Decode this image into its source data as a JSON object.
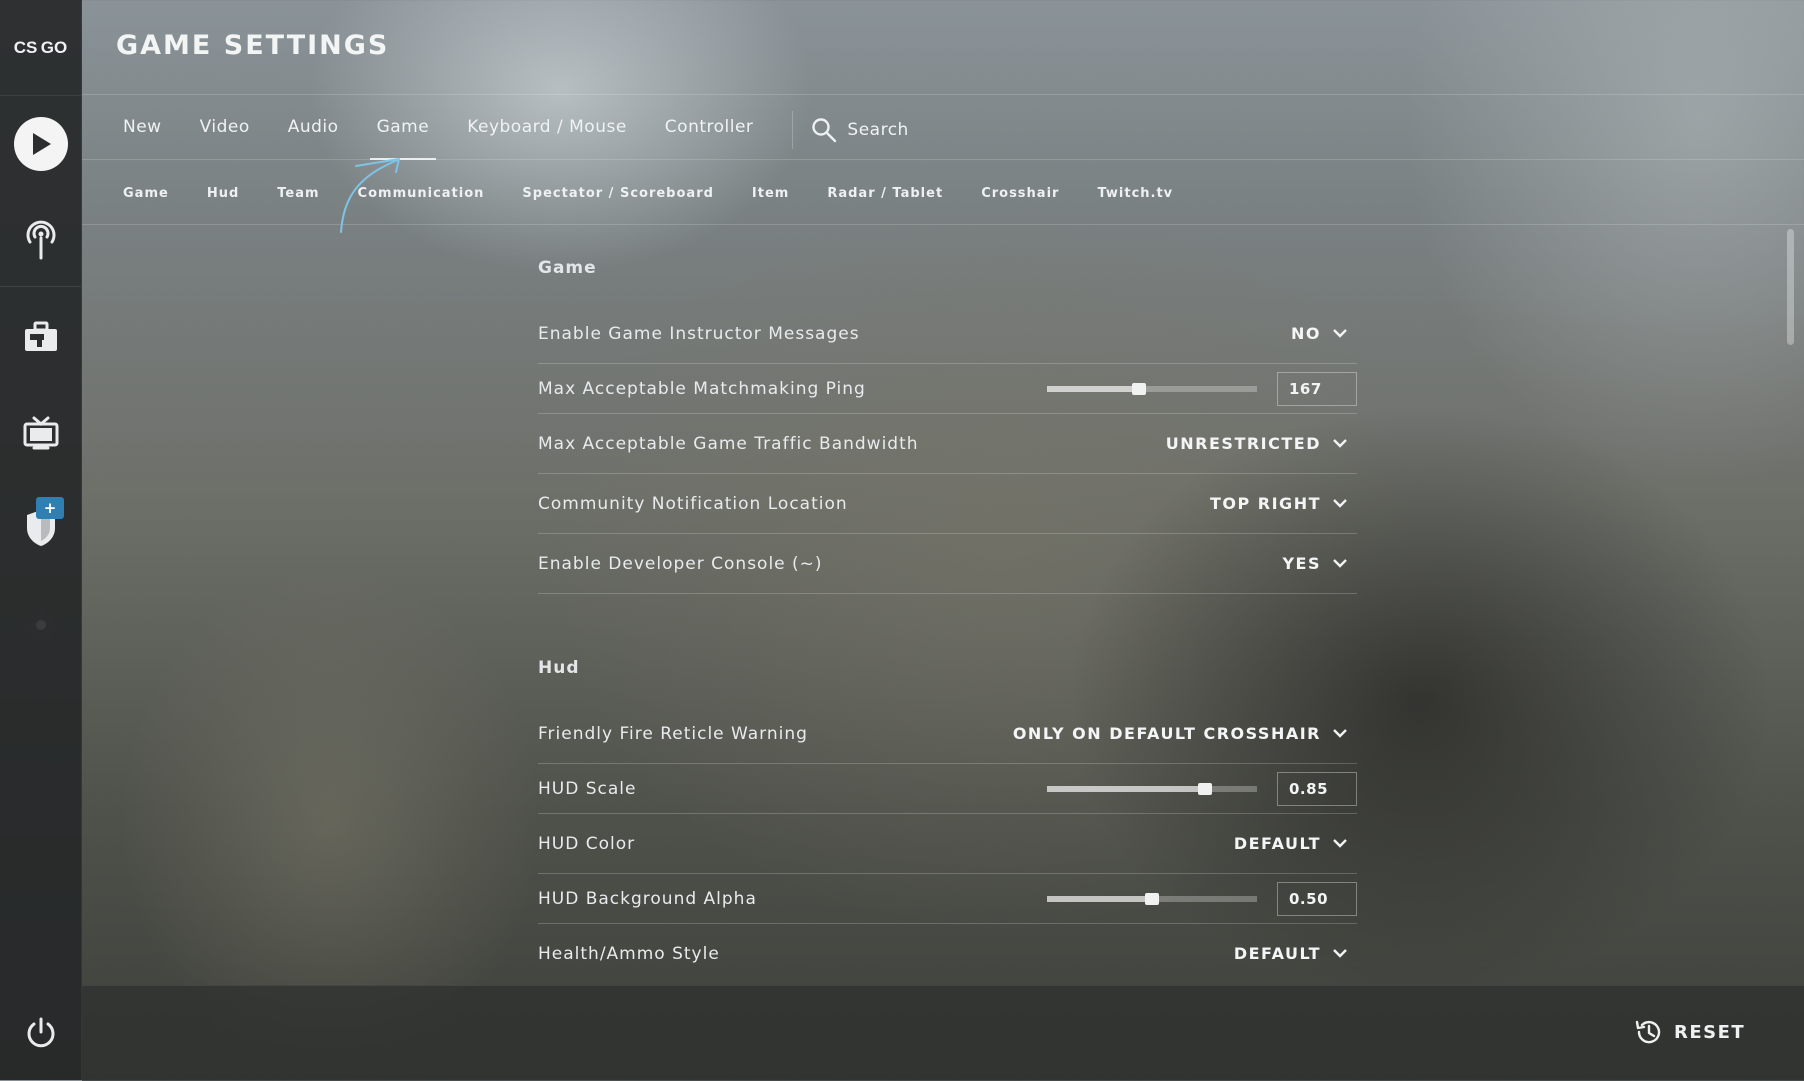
{
  "app": {
    "logo_text": "CS GO",
    "title": "GAME SETTINGS"
  },
  "tabs": [
    {
      "label": "New"
    },
    {
      "label": "Video"
    },
    {
      "label": "Audio"
    },
    {
      "label": "Game",
      "active": true
    },
    {
      "label": "Keyboard / Mouse"
    },
    {
      "label": "Controller"
    }
  ],
  "search": {
    "label": "Search"
  },
  "subtabs": [
    {
      "label": "Game"
    },
    {
      "label": "Hud"
    },
    {
      "label": "Team"
    },
    {
      "label": "Communication"
    },
    {
      "label": "Spectator / Scoreboard"
    },
    {
      "label": "Item"
    },
    {
      "label": "Radar / Tablet"
    },
    {
      "label": "Crosshair"
    },
    {
      "label": "Twitch.tv"
    }
  ],
  "sections": {
    "game": {
      "title": "Game",
      "rows": [
        {
          "label": "Enable Game Instructor Messages",
          "value": "NO"
        },
        {
          "label": "Max Acceptable Matchmaking Ping",
          "value": "167",
          "slider_fraction": 0.44
        },
        {
          "label": "Max Acceptable Game Traffic Bandwidth",
          "value": "UNRESTRICTED"
        },
        {
          "label": "Community Notification Location",
          "value": "TOP RIGHT"
        },
        {
          "label": "Enable Developer Console (~)",
          "value": "YES"
        }
      ]
    },
    "hud": {
      "title": "Hud",
      "rows": [
        {
          "label": "Friendly Fire Reticle Warning",
          "value": "ONLY ON DEFAULT CROSSHAIR"
        },
        {
          "label": "HUD Scale",
          "value": "0.85",
          "slider_fraction": 0.75
        },
        {
          "label": "HUD Color",
          "value": "DEFAULT"
        },
        {
          "label": "HUD Background Alpha",
          "value": "0.50",
          "slider_fraction": 0.5
        },
        {
          "label": "Health/Ammo Style",
          "value": "DEFAULT"
        }
      ]
    }
  },
  "footer": {
    "reset_label": "RESET"
  },
  "sidebar": {
    "badge": "+"
  },
  "colors": {
    "badge": "#2f7fb3",
    "annotation": "#7fc4e6"
  }
}
